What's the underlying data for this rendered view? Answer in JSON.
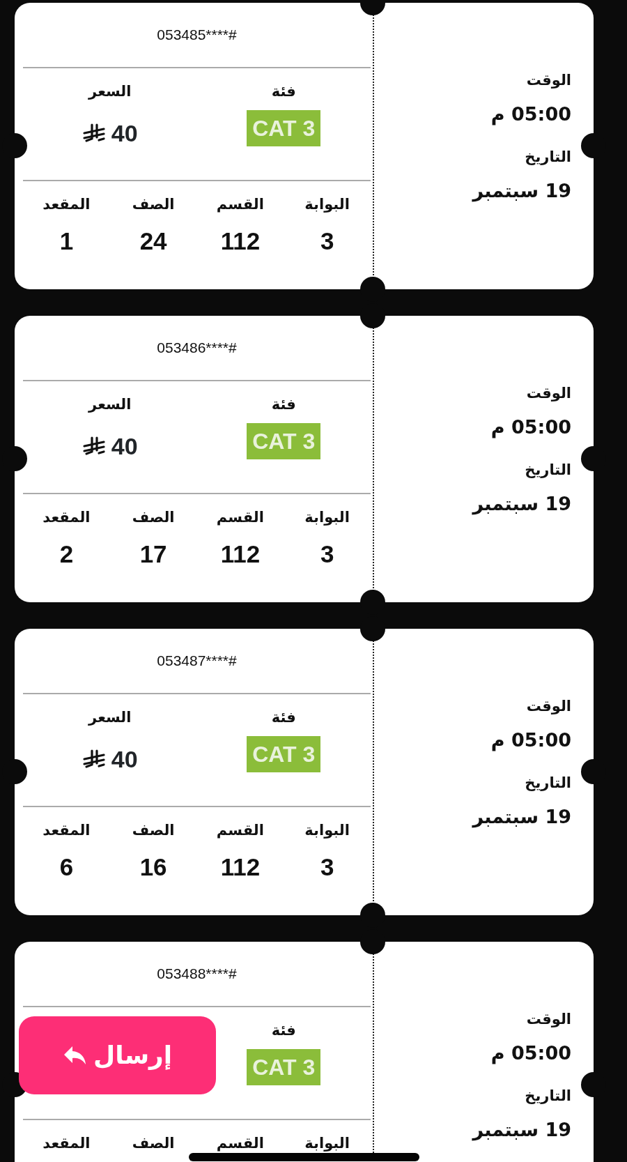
{
  "tickets": [
    {
      "serial": "053485****#",
      "category_label": "فئة",
      "category": "CAT 3",
      "price_label": "السعر",
      "price": "40",
      "fields": [
        {
          "label": "البوابة",
          "value": "3"
        },
        {
          "label": "القسم",
          "value": "112"
        },
        {
          "label": "الصف",
          "value": "24"
        },
        {
          "label": "المقعد",
          "value": "1"
        }
      ],
      "time_label": "الوقت",
      "time": "05:00 م",
      "date_label": "التاريخ",
      "date": "19 سبتمبر"
    },
    {
      "serial": "053486****#",
      "category_label": "فئة",
      "category": "CAT 3",
      "price_label": "السعر",
      "price": "40",
      "fields": [
        {
          "label": "البوابة",
          "value": "3"
        },
        {
          "label": "القسم",
          "value": "112"
        },
        {
          "label": "الصف",
          "value": "17"
        },
        {
          "label": "المقعد",
          "value": "2"
        }
      ],
      "time_label": "الوقت",
      "time": "05:00 م",
      "date_label": "التاريخ",
      "date": "19 سبتمبر"
    },
    {
      "serial": "053487****#",
      "category_label": "فئة",
      "category": "CAT 3",
      "price_label": "السعر",
      "price": "40",
      "fields": [
        {
          "label": "البوابة",
          "value": "3"
        },
        {
          "label": "القسم",
          "value": "112"
        },
        {
          "label": "الصف",
          "value": "16"
        },
        {
          "label": "المقعد",
          "value": "6"
        }
      ],
      "time_label": "الوقت",
      "time": "05:00 م",
      "date_label": "التاريخ",
      "date": "19 سبتمبر"
    },
    {
      "serial": "053488****#",
      "category_label": "فئة",
      "category": "CAT 3",
      "fields": [
        {
          "label": "البوابة"
        },
        {
          "label": "القسم"
        },
        {
          "label": "الصف"
        },
        {
          "label": "المقعد"
        }
      ],
      "time_label": "الوقت",
      "time": "05:00 م",
      "date_label": "التاريخ",
      "date": "19 سبتمبر"
    }
  ],
  "send_button": {
    "label": "إرسال"
  }
}
